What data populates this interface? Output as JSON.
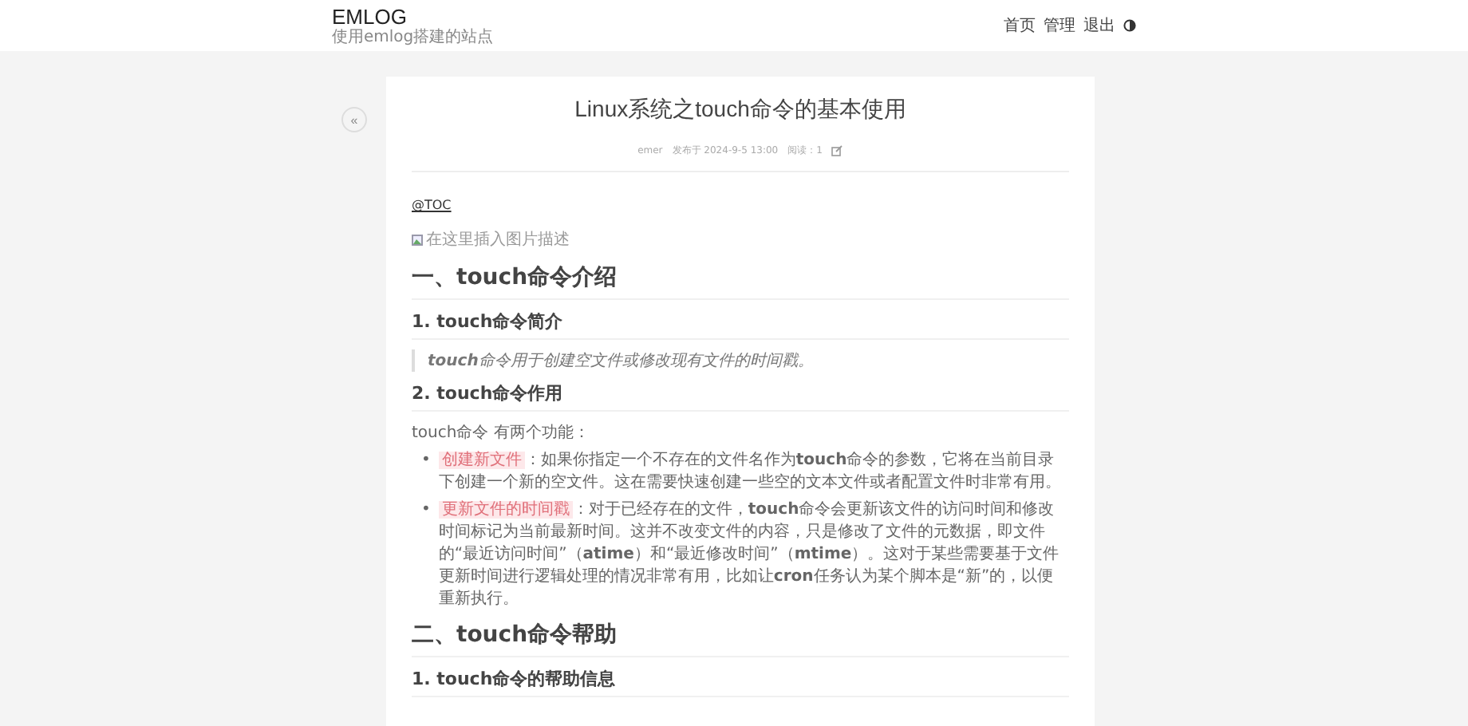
{
  "site": {
    "title": "EMLOG",
    "subtitle": "使用emlog搭建的站点"
  },
  "nav": [
    {
      "label": "首页"
    },
    {
      "label": "管理"
    },
    {
      "label": "退出"
    }
  ],
  "back_button": {
    "label": "«"
  },
  "article": {
    "title": "Linux系统之touch命令的基本使用",
    "meta": {
      "author": "emer",
      "published": "发布于 2024-9-5 13:00",
      "reads": "阅读：1"
    },
    "blocks": [
      {
        "kind": "link",
        "text": "@TOC"
      },
      {
        "kind": "image",
        "alt": "在这里插入图片描述"
      },
      {
        "kind": "h1",
        "text": "一、touch命令介绍"
      },
      {
        "kind": "h2",
        "text": "1. touch命令简介"
      },
      {
        "kind": "quote",
        "text": "**touch**命令用于创建空文件或修改现有文件的时间戳。"
      },
      {
        "kind": "h2",
        "text": "2. touch命令作用"
      },
      {
        "kind": "para",
        "text": "touch命令 有两个功能："
      },
      {
        "kind": "bullets",
        "items": [
          {
            "marker": "•",
            "tag": "创建新文件",
            "text": "：如果你指定一个不存在的文件名作为**touch**命令的参数，它将在当前目录下创建一个新的空文件。这在需要快速创建一些空的文本文件或者配置文件时非常有用。"
          },
          {
            "marker": "•",
            "tag": "更新文件的时间戳",
            "text": "：对于已经存在的文件，**touch**命令会更新该文件的访问时间和修改时间标记为当前最新时间。这并不改变文件的内容，只是修改了文件的元数据，即文件的“最近访问时间”（**atime**）和“最近修改时间”（**mtime**）。这对于某些需要基于文件更新时间进行逻辑处理的情况非常有用，比如让**cron**任务认为某个脚本是“新”的，以便重新执行。"
          }
        ]
      },
      {
        "kind": "h1",
        "text": "二、touch命令帮助"
      },
      {
        "kind": "h2",
        "text": "1. touch命令的帮助信息"
      }
    ]
  }
}
